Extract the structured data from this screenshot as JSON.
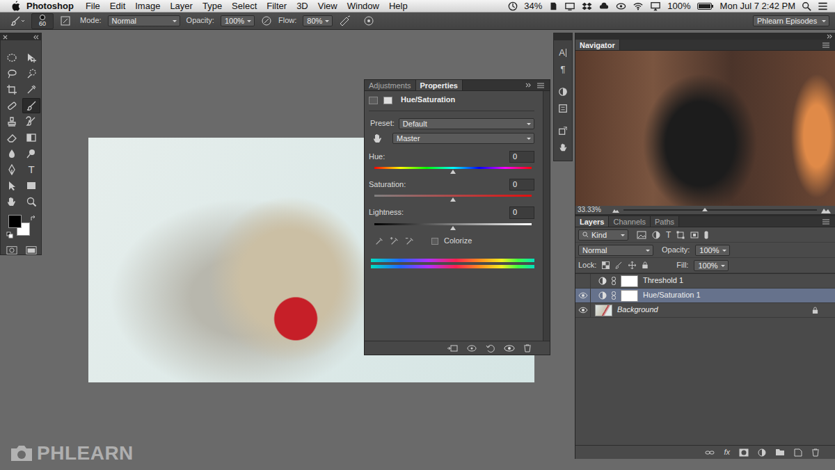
{
  "menubar": {
    "app": "Photoshop",
    "menus": [
      "File",
      "Edit",
      "Image",
      "Layer",
      "Type",
      "Select",
      "Filter",
      "3D",
      "View",
      "Window",
      "Help"
    ],
    "status_percent": "34%",
    "battery": "100%",
    "clock": "Mon Jul 7 2:42 PM"
  },
  "options_bar": {
    "brush_size": "60",
    "mode_label": "Mode:",
    "mode": "Normal",
    "opacity_label": "Opacity:",
    "opacity": "100%",
    "flow_label": "Flow:",
    "flow": "80%",
    "workspace": "Phlearn Episodes"
  },
  "tools_panel": {
    "tools": [
      {
        "selected": false
      },
      {
        "selected": false
      },
      {
        "selected": false
      },
      {
        "selected": false
      },
      {
        "selected": false
      },
      {
        "selected": false
      },
      {
        "selected": false
      },
      {
        "selected": true
      },
      {
        "selected": false
      },
      {
        "selected": false
      },
      {
        "selected": false
      },
      {
        "selected": false
      },
      {
        "selected": false
      },
      {
        "selected": false
      },
      {
        "selected": false
      },
      {
        "selected": false,
        "glyph": "T"
      },
      {
        "selected": false
      },
      {
        "selected": false
      },
      {
        "selected": false
      },
      {
        "selected": false
      }
    ],
    "foreground": "#000000",
    "background": "#ffffff"
  },
  "properties": {
    "tabs": [
      {
        "label": "Adjustments",
        "selected": false
      },
      {
        "label": "Properties",
        "selected": true
      }
    ],
    "title": "Hue/Saturation",
    "preset_label": "Preset:",
    "preset": "Default",
    "channel": "Master",
    "sliders": [
      {
        "label": "Hue:",
        "value": "0",
        "level": 0.5
      },
      {
        "label": "Saturation:",
        "value": "0",
        "level": 0.5
      },
      {
        "label": "Lightness:",
        "value": "0",
        "level": 0.5
      }
    ],
    "colorize": {
      "label": "Colorize",
      "checked": false
    }
  },
  "icon_strip": {
    "glyphs": [
      "A",
      "¶"
    ]
  },
  "navigator": {
    "title": "Navigator",
    "zoom": "33.33%",
    "zoom_level": 0.42
  },
  "layers": {
    "tabs": [
      {
        "label": "Layers",
        "selected": true
      },
      {
        "label": "Channels",
        "selected": false
      },
      {
        "label": "Paths",
        "selected": false
      }
    ],
    "filter": "Kind",
    "filter_type_glyph": "T",
    "blend_mode": "Normal",
    "opacity_label": "Opacity:",
    "opacity": "100%",
    "lock_label": "Lock:",
    "fill_label": "Fill:",
    "fill": "100%",
    "items": [
      {
        "name": "Threshold 1",
        "visible": false,
        "selected": false,
        "locked": false,
        "kind": "adjustment"
      },
      {
        "name": "Hue/Saturation 1",
        "visible": true,
        "selected": true,
        "locked": false,
        "kind": "adjustment"
      },
      {
        "name": "Background",
        "visible": true,
        "selected": false,
        "locked": true,
        "kind": "image"
      }
    ],
    "footer_fx": "fx"
  },
  "watermark": "PHLEARN"
}
